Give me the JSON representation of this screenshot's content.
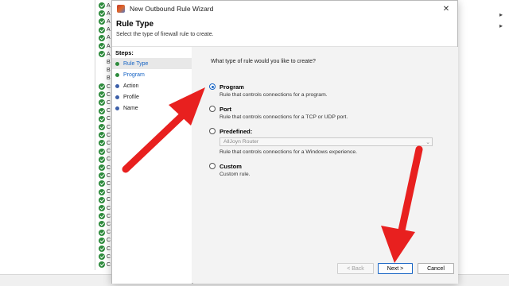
{
  "background_list": {
    "rows": [
      {
        "letter": "A",
        "status": "enabled"
      },
      {
        "letter": "A",
        "status": "enabled"
      },
      {
        "letter": "A",
        "status": "enabled"
      },
      {
        "letter": "A",
        "status": "enabled"
      },
      {
        "letter": "A",
        "status": "enabled"
      },
      {
        "letter": "A",
        "status": "enabled"
      },
      {
        "letter": "A",
        "status": "enabled"
      },
      {
        "letter": "B",
        "status": "none"
      },
      {
        "letter": "B",
        "status": "none"
      },
      {
        "letter": "B",
        "status": "none"
      },
      {
        "letter": "C",
        "status": "enabled"
      },
      {
        "letter": "C",
        "status": "enabled"
      },
      {
        "letter": "C",
        "status": "enabled"
      },
      {
        "letter": "C",
        "status": "enabled"
      },
      {
        "letter": "C",
        "status": "enabled"
      },
      {
        "letter": "C",
        "status": "enabled"
      },
      {
        "letter": "C",
        "status": "enabled"
      },
      {
        "letter": "C",
        "status": "enabled"
      },
      {
        "letter": "C",
        "status": "enabled"
      },
      {
        "letter": "C",
        "status": "enabled"
      },
      {
        "letter": "C",
        "status": "enabled"
      },
      {
        "letter": "C",
        "status": "enabled"
      },
      {
        "letter": "C",
        "status": "enabled"
      },
      {
        "letter": "C",
        "status": "enabled"
      },
      {
        "letter": "C",
        "status": "enabled"
      },
      {
        "letter": "C",
        "status": "enabled"
      },
      {
        "letter": "C",
        "status": "enabled"
      },
      {
        "letter": "C",
        "status": "enabled"
      },
      {
        "letter": "C",
        "status": "enabled"
      },
      {
        "letter": "C",
        "status": "enabled"
      },
      {
        "letter": "C",
        "status": "enabled"
      },
      {
        "letter": "C",
        "status": "enabled"
      },
      {
        "letter": "C",
        "status": "enabled"
      }
    ]
  },
  "dialog": {
    "title": "New Outbound Rule Wizard",
    "close_glyph": "✕",
    "header_title": "Rule Type",
    "header_subtitle": "Select the type of firewall rule to create.",
    "steps_title": "Steps:",
    "steps": [
      {
        "label": "Rule Type",
        "state": "current"
      },
      {
        "label": "Program",
        "state": "next"
      },
      {
        "label": "Action",
        "state": "pending"
      },
      {
        "label": "Profile",
        "state": "pending"
      },
      {
        "label": "Name",
        "state": "pending"
      }
    ],
    "question": "What type of rule would you like to create?",
    "options": [
      {
        "label": "Program",
        "description": "Rule that controls connections for a program.",
        "selected": true
      },
      {
        "label": "Port",
        "description": "Rule that controls connections for a TCP or UDP port.",
        "selected": false
      },
      {
        "label": "Predefined:",
        "description": "Rule that controls connections for a Windows experience.",
        "selected": false
      },
      {
        "label": "Custom",
        "description": "Custom rule.",
        "selected": false
      }
    ],
    "predefined_select_value": "AllJoyn Router",
    "buttons": {
      "back": "< Back",
      "next": "Next >",
      "cancel": "Cancel"
    }
  },
  "annotations": {
    "arrow_color": "#e8201f"
  },
  "colors": {
    "accent": "#1764c4",
    "enabled_green": "#2e8b3d"
  }
}
